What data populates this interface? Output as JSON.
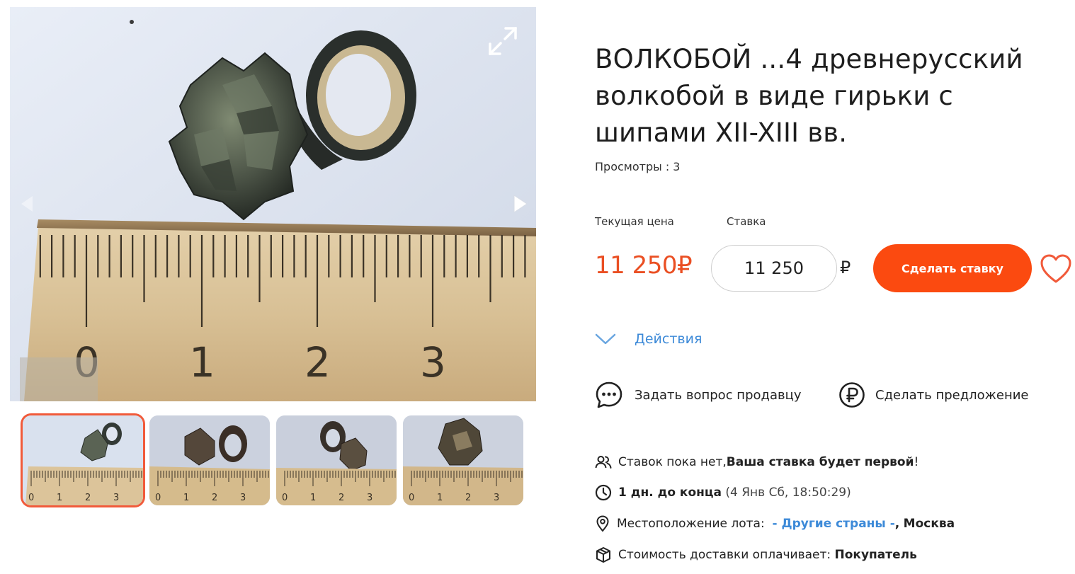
{
  "title": "ВОЛКОБОЙ ...4 древнерусский волкобой в виде гирьки с шипами XII-XIII вв.",
  "views_label": "Просмотры : 3",
  "price_section": {
    "current_price_label": "Текущая цена",
    "current_price": "11 250₽",
    "bid_label": "Ставка",
    "bid_value": "11 250",
    "currency": "₽",
    "bid_button": "Сделать ставку"
  },
  "actions_label": "Действия",
  "ask_seller": "Задать вопрос продавцу",
  "make_offer": "Сделать предложение",
  "bids": {
    "prefix": "Ставок пока нет, ",
    "emphasis": "Ваша ставка будет первой",
    "suffix": "!"
  },
  "time_left": {
    "value": "1 дн. до конца",
    "end": "(4 Янв Сб, 18:50:29)"
  },
  "location": {
    "label": "Местоположение лота:",
    "region": "- Другие страны -",
    "separator": ",",
    "city": "Москва"
  },
  "delivery": {
    "label": "Стоимость доставки оплачивает:",
    "payer": "Покупатель"
  },
  "ruler_numbers": [
    "0",
    "1",
    "2",
    "3"
  ],
  "thumb_ruler_numbers": [
    "0",
    "1",
    "2",
    "3"
  ],
  "colors": {
    "accent": "#fb4a10",
    "price": "#ea4f23",
    "link": "#3d8ad8",
    "thumb_border": "#f15a3a"
  },
  "icons": [
    "expand-icon",
    "arrow-right-icon",
    "arrow-left-icon",
    "heart-icon",
    "chevron-down-icon",
    "chat-icon",
    "ruble-circle-icon",
    "users-icon",
    "clock-icon",
    "location-pin-icon",
    "box-icon"
  ]
}
